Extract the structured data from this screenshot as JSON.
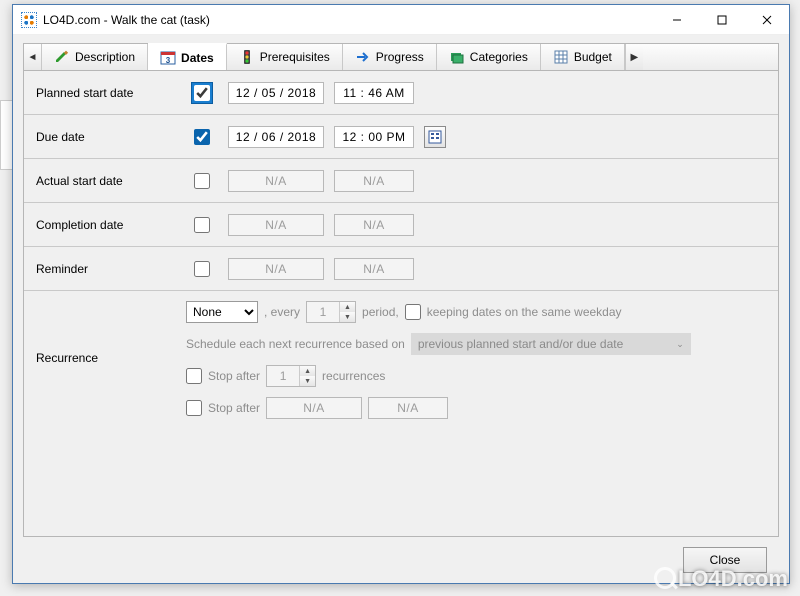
{
  "window": {
    "title": "LO4D.com - Walk the cat (task)"
  },
  "tabs": {
    "items": [
      {
        "label": "Description",
        "icon": "pencil-icon"
      },
      {
        "label": "Dates",
        "icon": "calendar-icon"
      },
      {
        "label": "Prerequisites",
        "icon": "traffic-light-icon"
      },
      {
        "label": "Progress",
        "icon": "arrow-right-icon"
      },
      {
        "label": "Categories",
        "icon": "folder-icon"
      },
      {
        "label": "Budget",
        "icon": "spreadsheet-icon"
      }
    ],
    "active_index": 1
  },
  "dates": {
    "planned_start": {
      "label": "Planned start date",
      "enabled": true,
      "date": "12 / 05 / 2018",
      "time": "11 : 46   AM"
    },
    "due": {
      "label": "Due date",
      "enabled": true,
      "date": "12 / 06 / 2018",
      "time": "12 : 00   PM"
    },
    "actual_start": {
      "label": "Actual start date",
      "enabled": false,
      "date": "N/A",
      "time": "N/A"
    },
    "completion": {
      "label": "Completion date",
      "enabled": false,
      "date": "N/A",
      "time": "N/A"
    },
    "reminder": {
      "label": "Reminder",
      "enabled": false,
      "date": "N/A",
      "time": "N/A"
    }
  },
  "recurrence": {
    "label": "Recurrence",
    "frequency": "None",
    "every_label_prefix": ", every",
    "every_value": "1",
    "every_label_suffix": "period,",
    "keeping_label": "keeping dates on the same weekday",
    "schedule_label": "Schedule each next recurrence based on",
    "schedule_basis": "previous planned start and/or due date",
    "stop_after_count_label": "Stop after",
    "stop_after_count_value": "1",
    "stop_after_count_suffix": "recurrences",
    "stop_after_date_label": "Stop after",
    "stop_after_date": "N/A",
    "stop_after_time": "N/A"
  },
  "footer": {
    "close": "Close"
  },
  "watermark": "LO4D.com"
}
